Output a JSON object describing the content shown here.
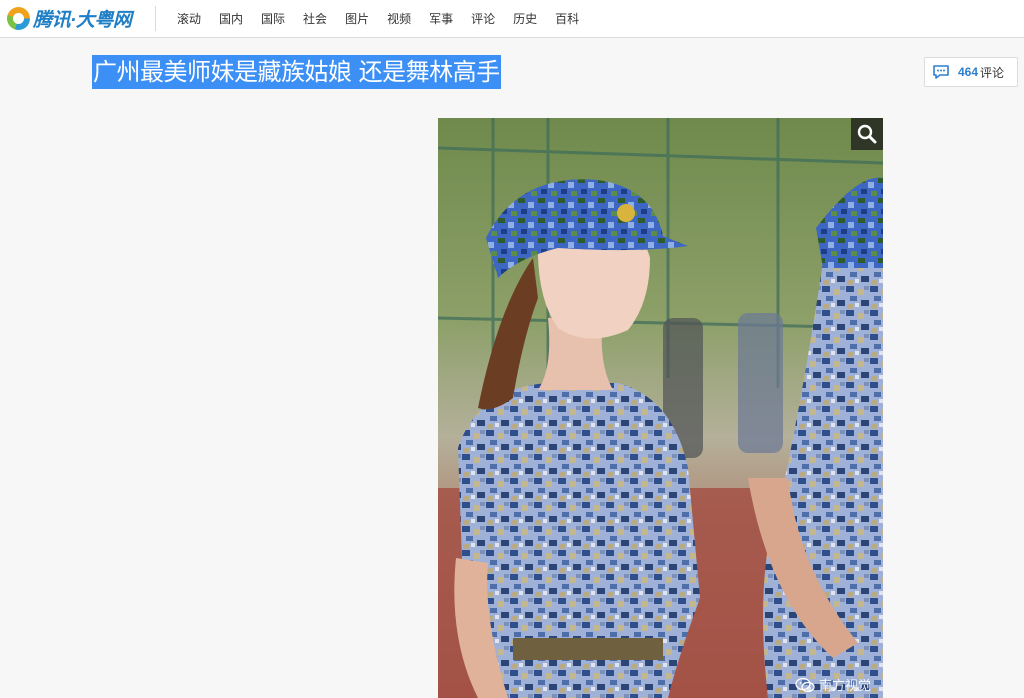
{
  "site": {
    "logo_text": "腾讯·大粤网"
  },
  "nav": {
    "items": [
      "滚动",
      "国内",
      "国际",
      "社会",
      "图片",
      "视频",
      "军事",
      "评论",
      "历史",
      "百科"
    ]
  },
  "article": {
    "title": "广州最美师妹是藏族姑娘 还是舞林高手"
  },
  "comments": {
    "count": "464",
    "label": "评论"
  },
  "photo": {
    "watermark": "南方视觉"
  },
  "colors": {
    "brand": "#1f7fc6",
    "highlight": "#3b8ff5",
    "comment_count": "#2d7fd0"
  },
  "icons": {
    "logo": "tencent-logo-icon",
    "comment": "comment-bubble-icon",
    "zoom": "magnifier-icon",
    "watermark": "wechat-icon"
  }
}
